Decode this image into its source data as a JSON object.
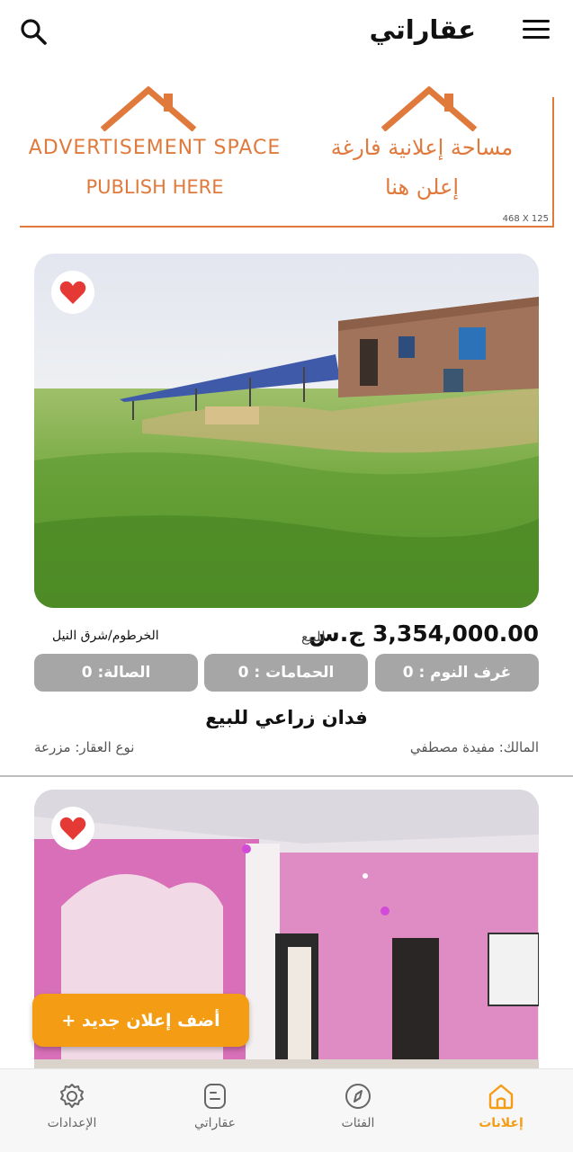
{
  "header": {
    "title": "عقاراتي"
  },
  "ad": {
    "en_line1": "ADVERTISEMENT SPACE",
    "en_line2": "PUBLISH HERE",
    "ar_line1": "مساحة إعلانية فارغة",
    "ar_line2": "إعلن هنا",
    "size": "468 X 125",
    "accent_color": "#e07a3c"
  },
  "listings": [
    {
      "price": "3,354,000.00 ج.س",
      "status": "للبيع",
      "location": "الخرطوم/شرق النيل",
      "bedrooms_label": "غرف النوم : 0",
      "bathrooms_label": "الحمامات : 0",
      "hall_label": "الصالة: 0",
      "title": "فدان زراعي للبيع",
      "owner": "المالك: مفيدة مصطفي",
      "property_type": "نوع العقار: مزرعة"
    },
    {
      "title": ""
    }
  ],
  "fab": {
    "label": "أضف إعلان جديد +"
  },
  "bottom_nav": [
    {
      "label": "الإعدادات",
      "icon": "gear-icon"
    },
    {
      "label": "عقاراتي",
      "icon": "document-icon"
    },
    {
      "label": "الفئات",
      "icon": "compass-icon"
    },
    {
      "label": "إعلانات",
      "icon": "home-icon",
      "active": true
    }
  ],
  "colors": {
    "accent": "#f39c14",
    "pill": "#a6a6a6",
    "favorite": "#e53935"
  }
}
